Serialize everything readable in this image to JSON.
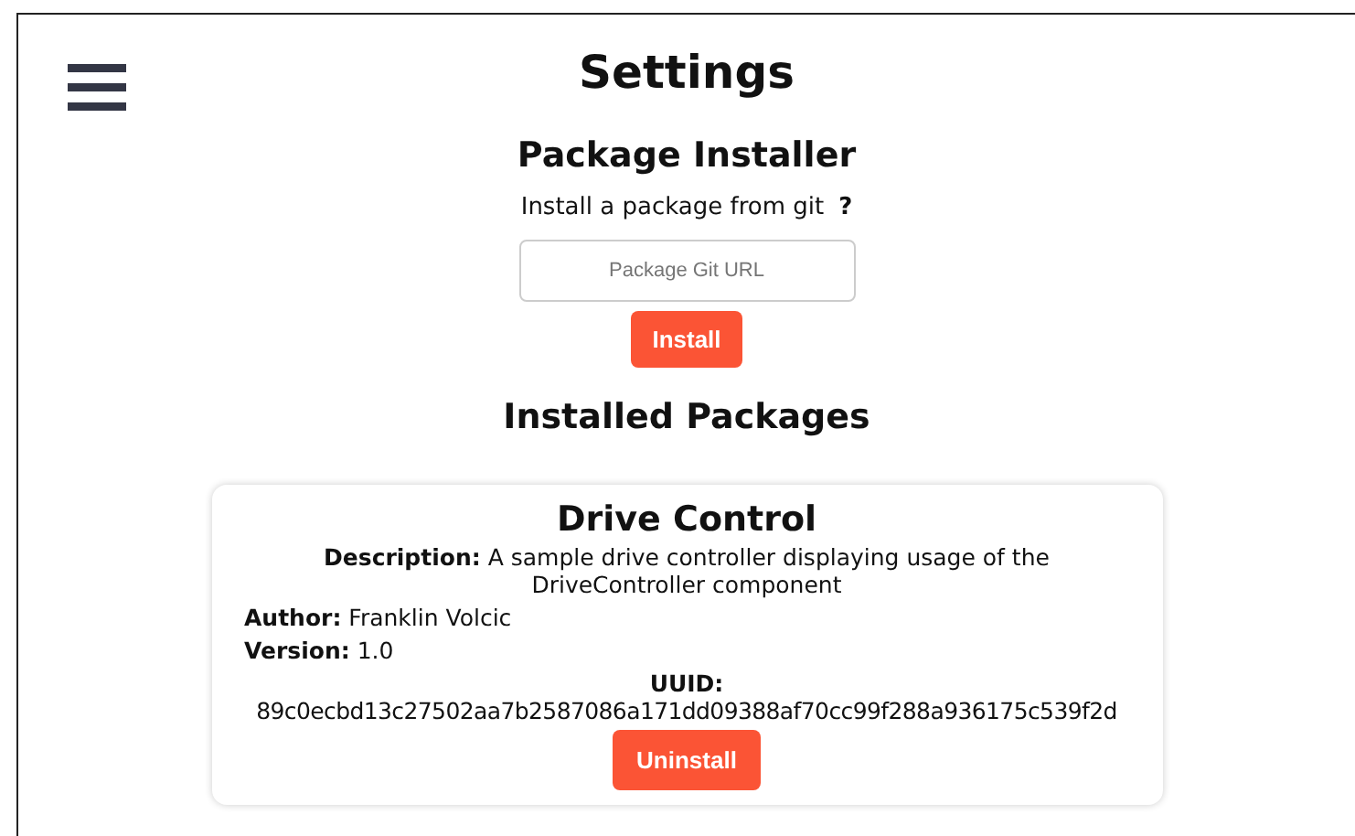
{
  "title": "Settings",
  "installer": {
    "heading": "Package Installer",
    "prompt": "Install a package from git",
    "help": "?",
    "url_field": {
      "placeholder": "Package Git URL"
    },
    "install_button": "Install"
  },
  "installed_heading": "Installed Packages",
  "packages": [
    {
      "name": "Drive Control",
      "description": "**Description:** A sample drive controller displaying usage of the DriveController component",
      "author": "**Author:** Franklin Volcic",
      "version": "**Version:** 1.0",
      "uuid_label": "UUID:",
      "uuid": "89c0ecbd13c27502aa7b2587086a171dd09388af70cc99f288a936175c539f2d",
      "button": "Uninstall"
    }
  ]
}
